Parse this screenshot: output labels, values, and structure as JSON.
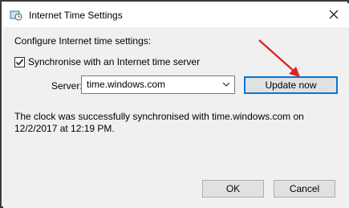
{
  "window": {
    "title": "Internet Time Settings",
    "title_icon": "clock-globe-icon",
    "close_icon": "close-icon"
  },
  "content": {
    "heading": "Configure Internet time settings:",
    "sync_checkbox": {
      "label": "Synchronise with an Internet time server",
      "checked": true
    },
    "server": {
      "label": "Server:",
      "value": "time.windows.com"
    },
    "update_button": "Update now",
    "status_line1": "The clock was successfully synchronised with time.windows.com on",
    "status_line2": "12/2/2017 at 12:19 PM."
  },
  "buttons": {
    "ok": "OK",
    "cancel": "Cancel"
  },
  "colors": {
    "accent": "#0078d7",
    "annotation": "#e02020",
    "client_bg": "#f0f0f0"
  }
}
